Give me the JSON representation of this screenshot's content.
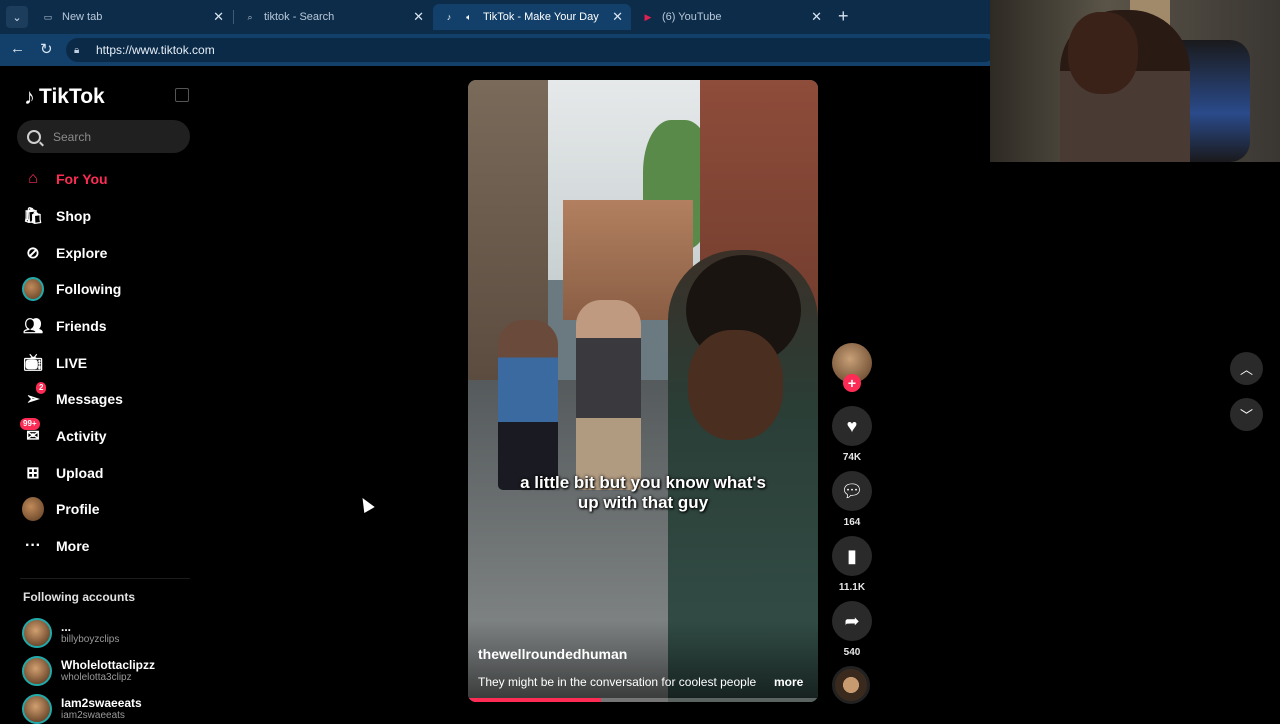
{
  "browser": {
    "tabs": [
      {
        "label": "New tab",
        "icon": "page-icon"
      },
      {
        "label": "tiktok - Search",
        "icon": "search-icon"
      },
      {
        "label": "TikTok - Make Your Day",
        "icon": "tiktok-icon",
        "active": true,
        "audio": true
      },
      {
        "label": "(6) YouTube",
        "icon": "youtube-icon"
      }
    ],
    "url": "https://www.tiktok.com"
  },
  "sidebar": {
    "logo": "TikTok",
    "search_placeholder": "Search",
    "items": [
      {
        "label": "For You",
        "icon": "home-icon",
        "active": true
      },
      {
        "label": "Shop",
        "icon": "shopping-bag-icon"
      },
      {
        "label": "Explore",
        "icon": "compass-icon"
      },
      {
        "label": "Following",
        "icon": "following-avatar"
      },
      {
        "label": "Friends",
        "icon": "friends-icon"
      },
      {
        "label": "LIVE",
        "icon": "live-tv-icon"
      },
      {
        "label": "Messages",
        "icon": "paper-plane-icon",
        "badge": "2"
      },
      {
        "label": "Activity",
        "icon": "notification-icon",
        "badge": "99+"
      },
      {
        "label": "Upload",
        "icon": "plus-square-icon"
      },
      {
        "label": "Profile",
        "icon": "profile-avatar"
      },
      {
        "label": "More",
        "icon": "ellipsis-icon"
      }
    ],
    "following_title": "Following accounts",
    "accounts": [
      {
        "name": "...",
        "handle": "billyboyzclips"
      },
      {
        "name": "Wholelottaclipzz",
        "handle": "wholelotta3clipz"
      },
      {
        "name": "Iam2swaeeats",
        "handle": "iam2swaeeats"
      }
    ]
  },
  "video": {
    "caption_line1": "a little bit but you know what's",
    "caption_line2": "up with that guy",
    "username": "thewellroundedhuman",
    "description": "They might be in the conversation for coolest people",
    "more": "more",
    "progress": 0.38
  },
  "actions": {
    "likes": "74K",
    "comments": "164",
    "saves": "11.1K",
    "shares": "540"
  },
  "colors": {
    "accent": "#fe2c55",
    "browser_tabbar": "#0c2c4a",
    "browser_active": "#12406a"
  }
}
